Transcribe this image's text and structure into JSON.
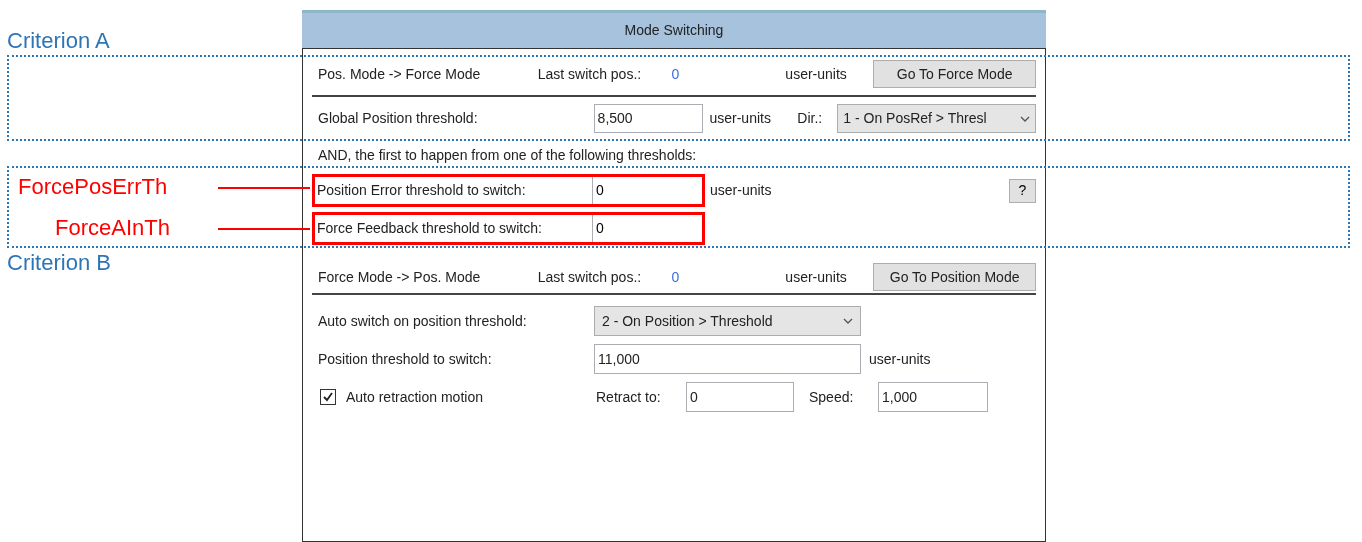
{
  "annotations": {
    "criteria": [
      {
        "label": "Criterion A"
      },
      {
        "label": "Criterion B"
      }
    ],
    "callouts": [
      {
        "label": "ForcePosErrTh"
      },
      {
        "label": "ForceAInTh"
      }
    ]
  },
  "window": {
    "title": "Mode Switching"
  },
  "pos_to_force": {
    "title": "Pos. Mode -> Force Mode",
    "last_label": "Last switch pos.:",
    "last_value": "0",
    "units": "user-units",
    "button": "Go To Force Mode"
  },
  "global_threshold": {
    "label": "Global Position threshold:",
    "value": "8,500",
    "units": "user-units",
    "dir_label": "Dir.:",
    "dir_value": "1 - On PosRef > Thresl"
  },
  "and_note": "AND, the first to happen from one of the following thresholds:",
  "thresholds": [
    {
      "label": "Position Error threshold to switch:",
      "value": "0",
      "units": "user-units",
      "help": "?",
      "highlighted": true
    },
    {
      "label": "Force Feedback threshold to switch:",
      "value": "0",
      "highlighted": true
    }
  ],
  "force_to_pos": {
    "title": "Force Mode -> Pos. Mode",
    "last_label": "Last switch pos.:",
    "last_value": "0",
    "units": "user-units",
    "button": "Go To Position Mode"
  },
  "auto_switch": {
    "label": "Auto switch on position threshold:",
    "value": "2 - On Position > Threshold"
  },
  "position_threshold": {
    "label": "Position threshold to switch:",
    "value": "11,000",
    "units": "user-units"
  },
  "retraction": {
    "label": "Auto retraction motion",
    "checked": true,
    "retract_label": "Retract to:",
    "retract_value": "0",
    "speed_label": "Speed:",
    "speed_value": "1,000"
  }
}
